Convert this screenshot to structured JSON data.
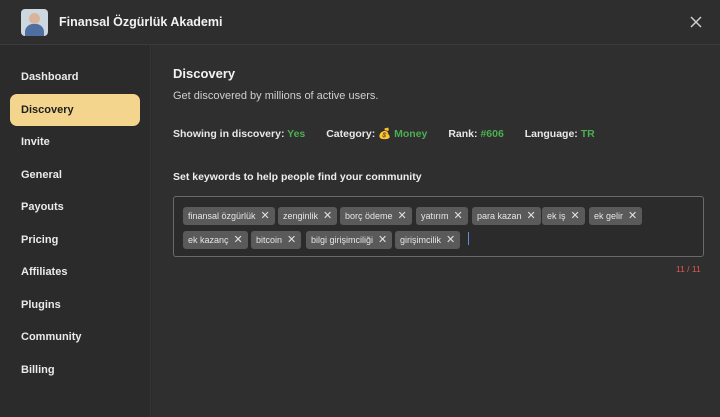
{
  "header": {
    "app_title": "Finansal Özgürlük Akademi"
  },
  "sidebar": {
    "items": [
      {
        "label": "Dashboard",
        "active": false
      },
      {
        "label": "Discovery",
        "active": true
      },
      {
        "label": "Invite",
        "active": false
      },
      {
        "label": "General",
        "active": false
      },
      {
        "label": "Payouts",
        "active": false
      },
      {
        "label": "Pricing",
        "active": false
      },
      {
        "label": "Affiliates",
        "active": false
      },
      {
        "label": "Plugins",
        "active": false
      },
      {
        "label": "Community",
        "active": false
      },
      {
        "label": "Billing",
        "active": false
      }
    ]
  },
  "main": {
    "title": "Discovery",
    "subtitle": "Get discovered by millions of active users.",
    "stats": {
      "showing_label": "Showing in discovery:",
      "showing_value": "Yes",
      "category_label": "Category:",
      "category_icon": "💰",
      "category_value": "Money",
      "rank_label": "Rank:",
      "rank_value": "#606",
      "language_label": "Language:",
      "language_value": "TR"
    },
    "keywords_heading": "Set keywords to help people find your community",
    "keywords": [
      "finansal özgürlük",
      "zenginlik",
      "borç ödeme",
      "yatırım",
      "para kazan",
      "ek iş",
      "ek gelir",
      "ek kazanç",
      "bitcoin",
      "bilgi girişimciliği",
      "girişimcilik"
    ],
    "counter": "11 / 11"
  },
  "colors": {
    "accent": "#f4d58d",
    "stat_value": "#4caf50",
    "counter": "#e2574c"
  }
}
